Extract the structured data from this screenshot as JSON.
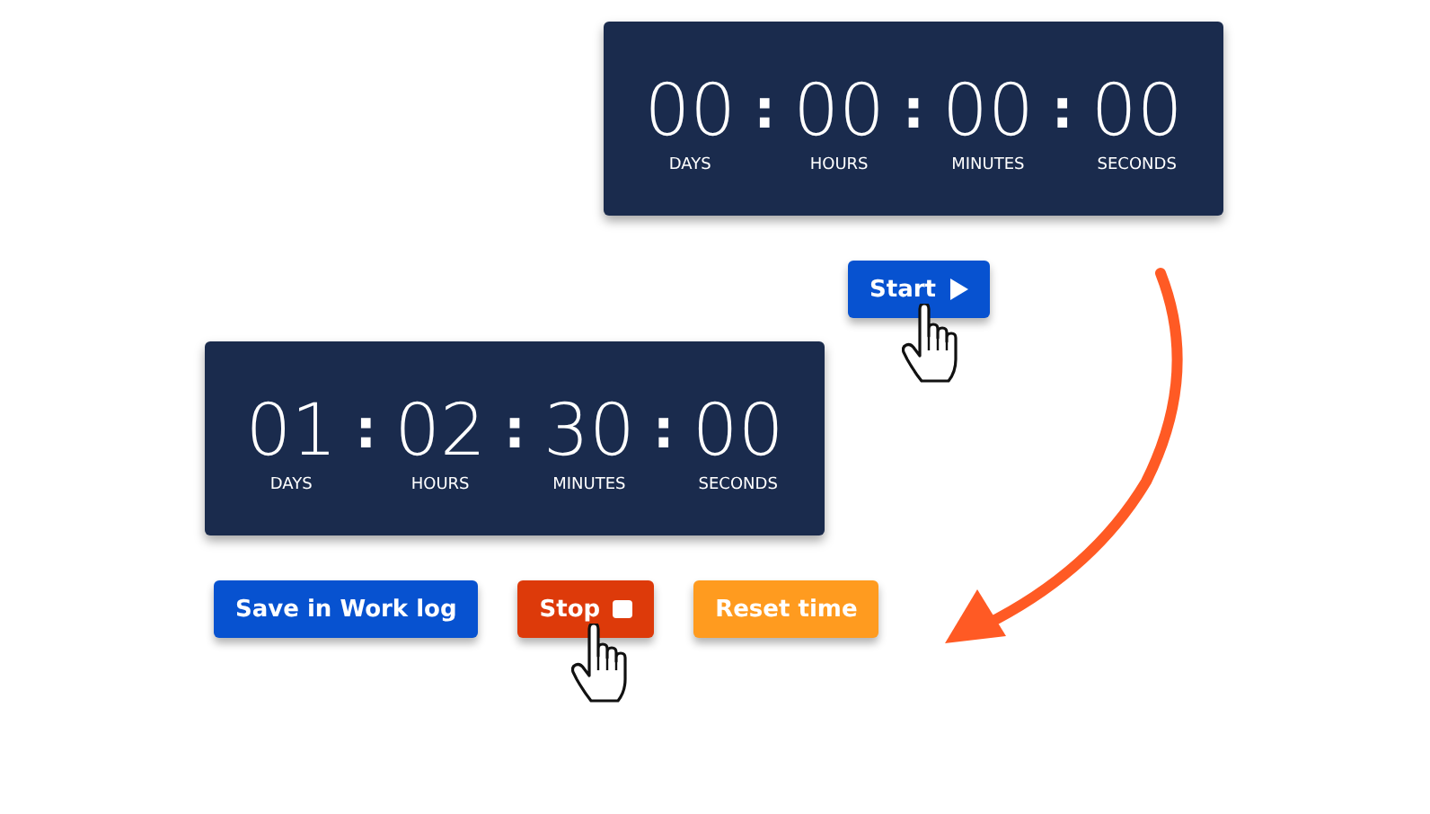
{
  "steps": [
    {
      "timer": {
        "units": [
          {
            "value": "00",
            "label": "DAYS"
          },
          {
            "value": "00",
            "label": "HOURS"
          },
          {
            "value": "00",
            "label": "MINUTES"
          },
          {
            "value": "00",
            "label": "SECONDS"
          }
        ],
        "separators": [
          ":",
          ":",
          ":"
        ]
      },
      "buttons": [
        {
          "label": "Start",
          "kind": "start",
          "pressed": true
        }
      ]
    },
    {
      "timer": {
        "units": [
          {
            "value": "01",
            "label": "DAYS"
          },
          {
            "value": "02",
            "label": "HOURS"
          },
          {
            "value": "30",
            "label": "MINUTES"
          },
          {
            "value": "00",
            "label": "SECONDS"
          }
        ],
        "separators": [
          ":",
          ":",
          ":"
        ]
      },
      "buttons": [
        {
          "label": "Save in Work log",
          "kind": "save",
          "pressed": false
        },
        {
          "label": "Stop",
          "kind": "stop",
          "pressed": true
        },
        {
          "label": "Reset time",
          "kind": "reset",
          "pressed": false
        }
      ]
    }
  ]
}
